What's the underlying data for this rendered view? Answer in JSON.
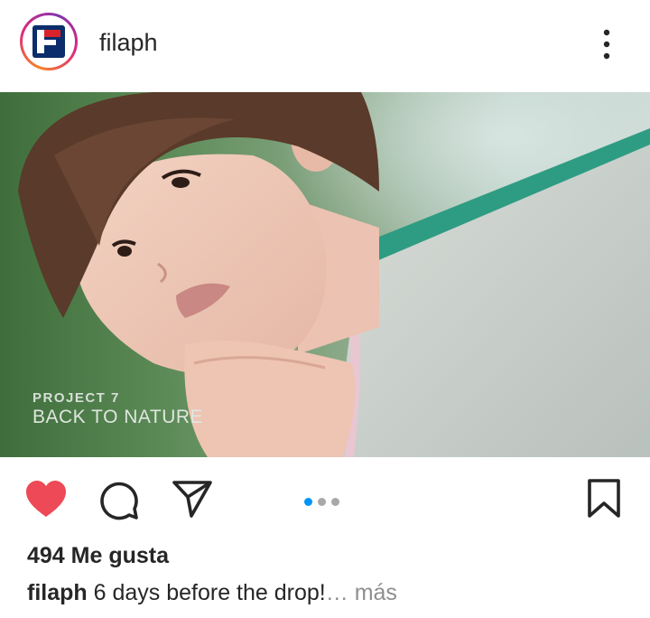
{
  "header": {
    "username": "filaph",
    "avatar_icon": "fila-logo-icon",
    "more_icon": "more-options-icon"
  },
  "media": {
    "overlay_line1": "PROJECT 7",
    "overlay_line2": "BACK TO NATURE",
    "carousel": {
      "count": 3,
      "active_index": 0
    }
  },
  "actions": {
    "like_icon": "heart-filled-icon",
    "comment_icon": "comment-icon",
    "share_icon": "send-icon",
    "save_icon": "bookmark-icon"
  },
  "likes": {
    "text": "494 Me gusta"
  },
  "caption": {
    "username": "filaph",
    "text": "6 days before the drop!",
    "ellipsis": "…",
    "more": "más"
  },
  "colors": {
    "like_red": "#ed4956",
    "active_dot": "#0095f6",
    "inactive_dot": "#a8a8a8",
    "fila_navy": "#0b2d6b",
    "fila_red": "#d8232a"
  }
}
